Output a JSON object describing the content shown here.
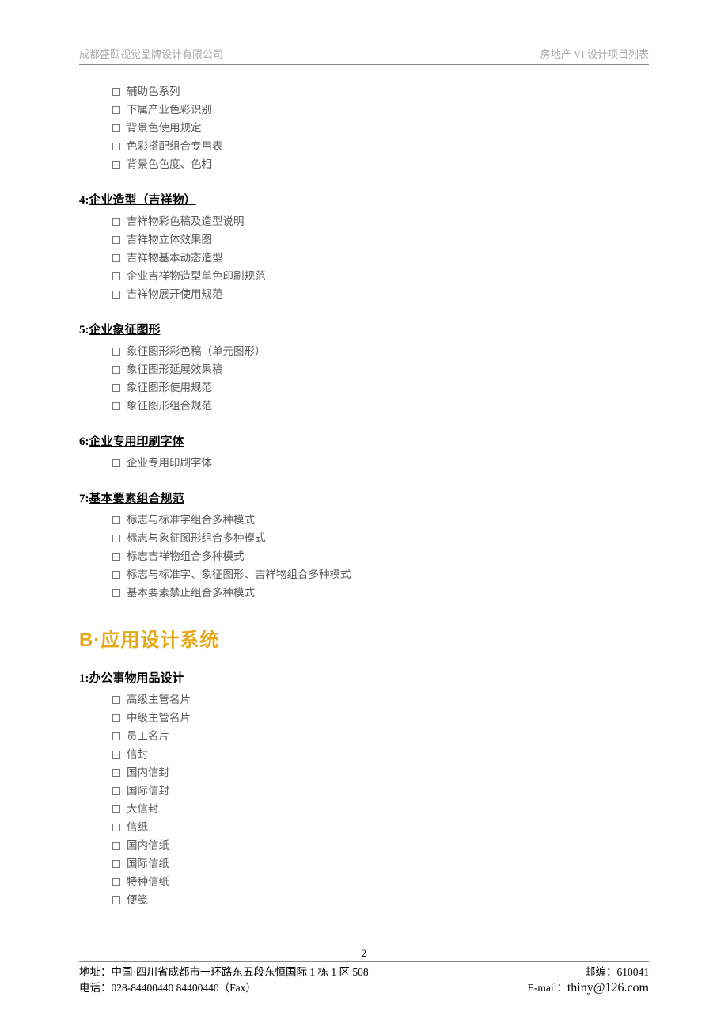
{
  "header": {
    "left": "成都盛颐视觉品牌设计有限公司",
    "right": "房地产 VI 设计项目列表"
  },
  "orphan_items": [
    "辅助色系列",
    "下属产业色彩识别",
    "背景色使用规定",
    "色彩搭配组合专用表",
    "背景色色度、色相"
  ],
  "sections": [
    {
      "num": "4:",
      "title": "企业造型（吉祥物）",
      "items": [
        "吉祥物彩色稿及造型说明",
        "吉祥物立体效果图",
        "吉祥物基本动态造型",
        "企业吉祥物造型单色印刷规范",
        "吉祥物展开使用规范"
      ]
    },
    {
      "num": "5:",
      "title": "企业象征图形",
      "items": [
        "象征图形彩色稿（单元图形）",
        "象征图形延展效果稿",
        "象征图形使用规范",
        "象征图形组合规范"
      ]
    },
    {
      "num": "6:",
      "title": "企业专用印刷字体",
      "items": [
        "企业专用印刷字体"
      ]
    },
    {
      "num": "7:",
      "title": "基本要素组合规范",
      "items": [
        "标志与标准字组合多种模式",
        "标志与象征图形组合多种模式",
        "标志吉祥物组合多种模式",
        "标志与标准字、象征图形、吉祥物组合多种模式",
        "基本要素禁止组合多种模式"
      ]
    }
  ],
  "major_b": "B·应用设计系统",
  "section_b1": {
    "num": "1:",
    "title": "办公事物用品设计",
    "items": [
      "高级主管名片",
      "中级主管名片",
      "员工名片",
      "信封",
      "国内信封",
      "国际信封",
      "大信封",
      "信纸",
      "国内信纸",
      "国际信纸",
      "特种信纸",
      "便笺"
    ]
  },
  "footer": {
    "page": "2",
    "addr_label": "地址：",
    "addr": "中国·四川省成都市一环路东五段东恒国际 1 栋 1 区 508",
    "post_label": "邮编：",
    "post": "610041",
    "tel_label": "电话：",
    "tel": "028-84400440    84400440（Fax）",
    "email_label": "E-mail：",
    "email": "thiny@126.com"
  }
}
